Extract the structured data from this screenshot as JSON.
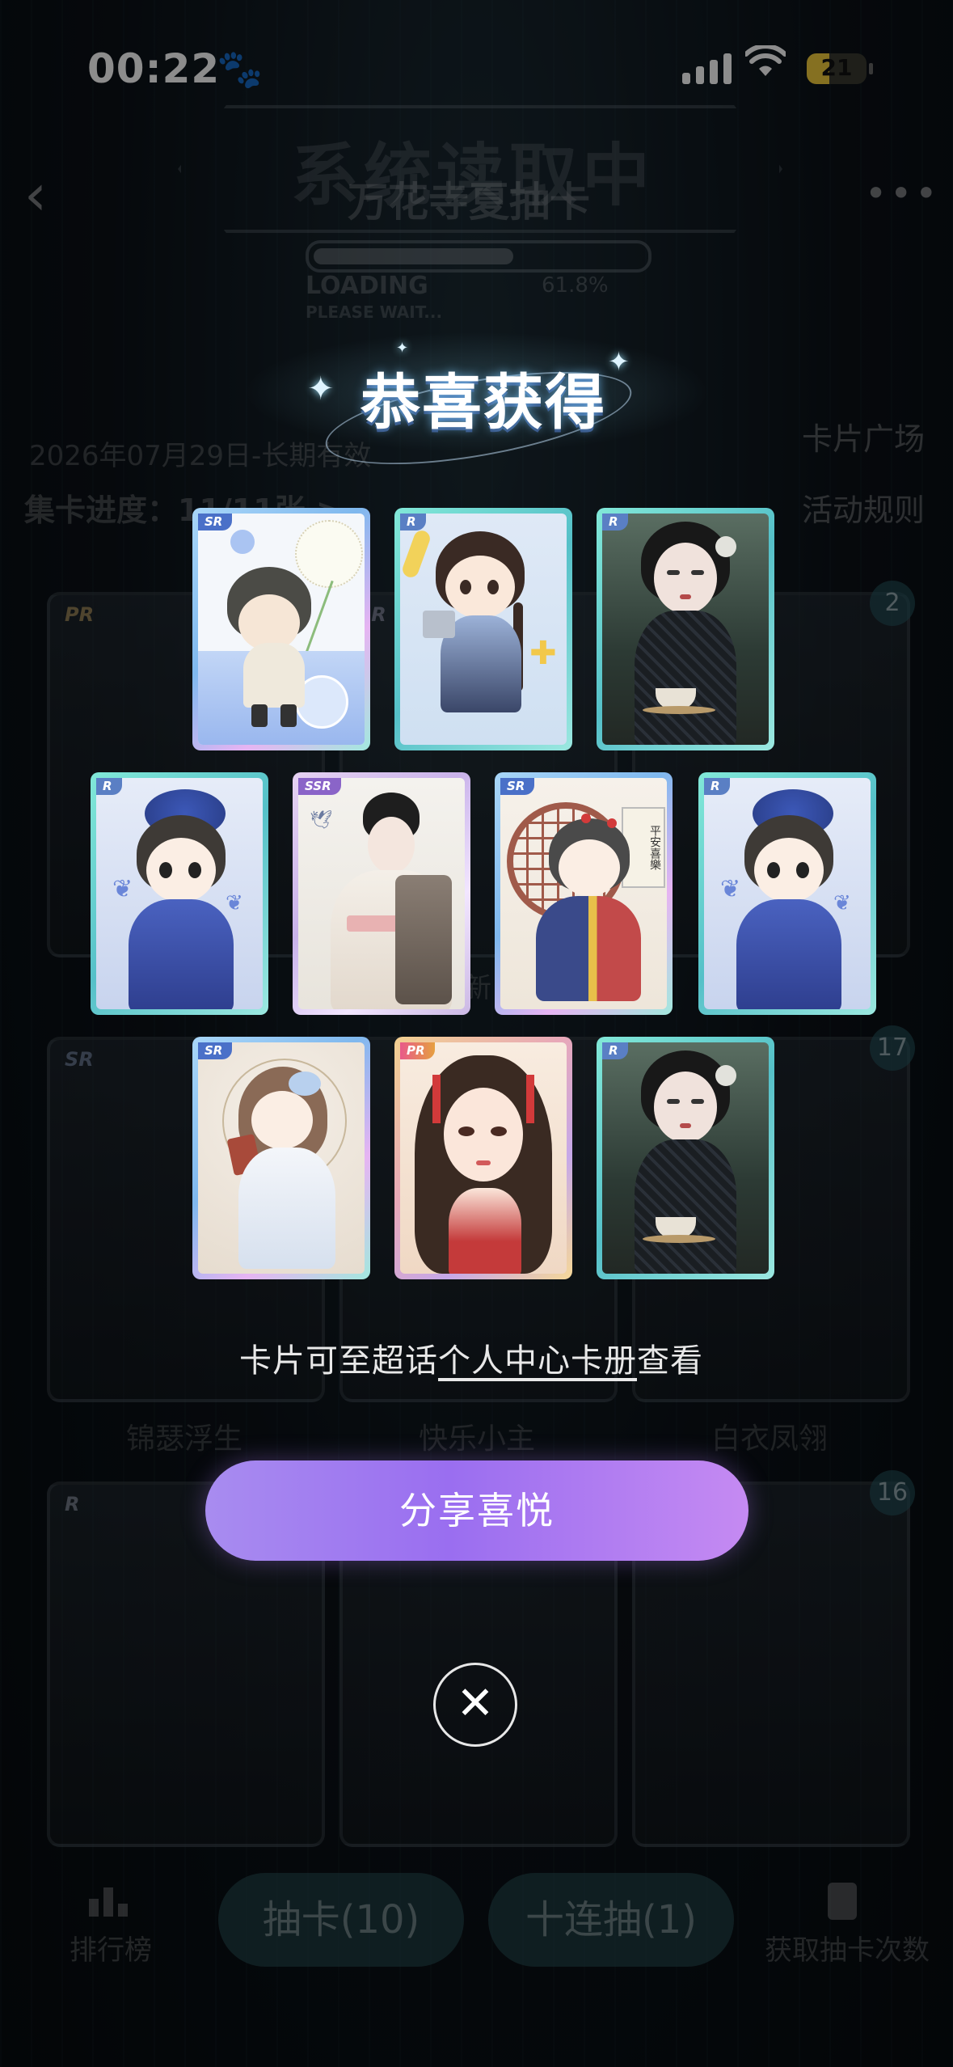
{
  "status_bar": {
    "time": "00:22",
    "battery": "21"
  },
  "header": {
    "system_banner": "系统读取中",
    "page_title": "万花寺夏抽卡",
    "loading_label": "LOADING",
    "loading_percent": "61.8%",
    "please_wait": "PLEASE WAIT...",
    "loading_progress": 0.618
  },
  "info": {
    "date": "2026年07月29日-长期有效",
    "collect_progress": "集卡进度：11/11张 >",
    "card_plaza": "卡片广场",
    "rules": "活动规则"
  },
  "background_cards": {
    "row1": [
      {
        "rarity": "PR"
      },
      {
        "rarity": "SR"
      },
      {
        "rarity": "R",
        "count": "2"
      }
    ],
    "row2": [
      {
        "rarity": "SR"
      },
      {
        "rarity": "R"
      },
      {
        "rarity": "R",
        "count": "17"
      }
    ],
    "row2_names": [
      "锦瑟浮生",
      "快乐小主",
      "白衣凤翎"
    ],
    "row3": [
      {
        "rarity": "R"
      },
      {
        "rarity": "R"
      },
      {
        "rarity": "R",
        "count": "16"
      }
    ],
    "fragment_text": "新"
  },
  "bottom_bar": {
    "leaderboard": "排行榜",
    "draw_one": "抽卡(10)",
    "draw_ten": "十连抽(1)",
    "get_chances": "获取抽卡次数"
  },
  "modal": {
    "title": "恭喜获得",
    "cards": [
      {
        "rarity": "SR",
        "theme": "dandelion-boy"
      },
      {
        "rarity": "R",
        "theme": "chibi-hanfu-girl"
      },
      {
        "rarity": "R",
        "theme": "qipao-tea-lady"
      },
      {
        "rarity": "R",
        "theme": "blue-flower-chibi"
      },
      {
        "rarity": "SSR",
        "theme": "white-hanfu-lady"
      },
      {
        "rarity": "SR",
        "theme": "window-chibi"
      },
      {
        "rarity": "R",
        "theme": "blue-flower-chibi"
      },
      {
        "rarity": "SR",
        "theme": "book-chibi"
      },
      {
        "rarity": "PR",
        "theme": "red-ribbon-girl"
      },
      {
        "rarity": "R",
        "theme": "qipao-tea-lady"
      }
    ],
    "window_sign": "平安喜樂",
    "hint_prefix": "卡片可至超话",
    "hint_link": "个人中心卡册",
    "hint_suffix": "查看",
    "share_button": "分享喜悦",
    "close_glyph": "✕"
  }
}
